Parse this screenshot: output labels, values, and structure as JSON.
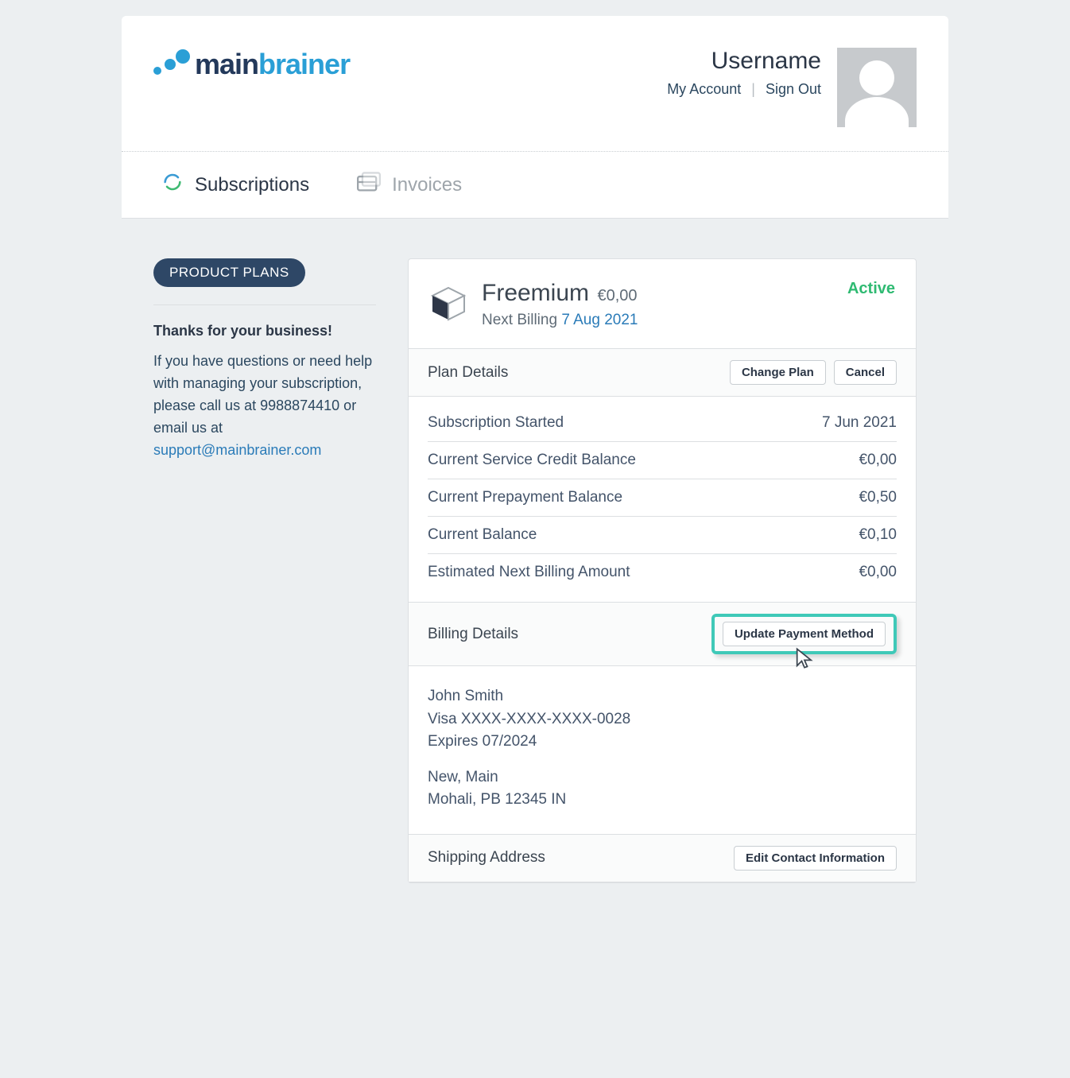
{
  "logo": {
    "part1": "main",
    "part2": "brainer"
  },
  "header": {
    "username": "Username",
    "my_account": "My Account",
    "sign_out": "Sign Out"
  },
  "tabs": {
    "subscriptions": "Subscriptions",
    "invoices": "Invoices"
  },
  "sidebar": {
    "pill": "PRODUCT PLANS",
    "thanks": "Thanks for your business!",
    "msg_line1": "If you have questions or need help with managing your subscription, please call us at 9988874410 or email us at ",
    "support_email": "support@mainbrainer.com"
  },
  "plan": {
    "name": "Freemium",
    "price": "€0,00",
    "next_billing_label": "Next Billing ",
    "next_billing_date": "7 Aug 2021",
    "status": "Active"
  },
  "plan_actions": {
    "change": "Change Plan",
    "cancel": "Cancel"
  },
  "sections": {
    "plan_details": "Plan Details",
    "billing_details": "Billing Details",
    "shipping": "Shipping Address"
  },
  "details": [
    {
      "label": "Subscription Started",
      "value": "7 Jun 2021"
    },
    {
      "label": "Current Service Credit Balance",
      "value": "€0,00"
    },
    {
      "label": "Current Prepayment Balance",
      "value": "€0,50"
    },
    {
      "label": "Current Balance",
      "value": "€0,10"
    },
    {
      "label": "Estimated Next Billing Amount",
      "value": "€0,00"
    }
  ],
  "billing_actions": {
    "update": "Update Payment Method"
  },
  "billing": {
    "name": "John Smith",
    "card": "Visa XXXX-XXXX-XXXX-0028",
    "expires": "Expires 07/2024",
    "addr1": "New, Main",
    "addr2": "Mohali, PB 12345 IN"
  },
  "shipping_actions": {
    "edit": "Edit Contact Information"
  }
}
